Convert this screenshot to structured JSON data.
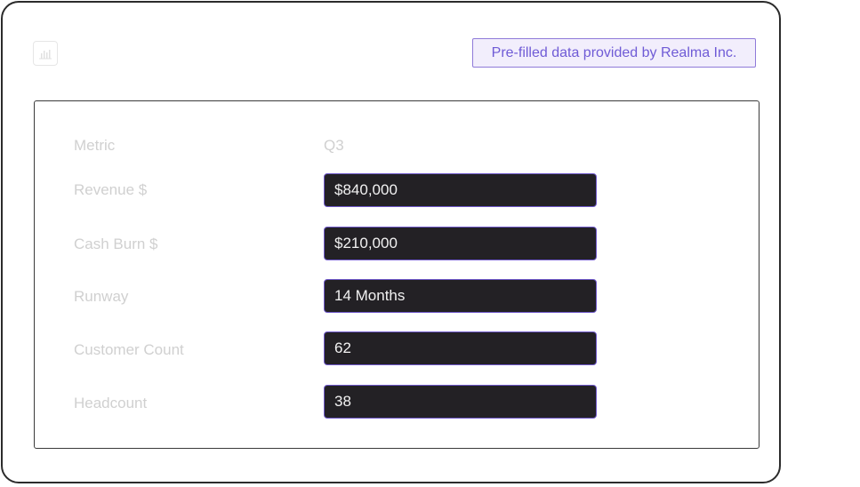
{
  "header": {
    "chart_icon": "bar-chart-icon",
    "prefill_notice": "Pre-filled data provided by Realma Inc."
  },
  "table": {
    "columns": {
      "metric": "Metric",
      "period": "Q3"
    },
    "rows": [
      {
        "label": "Revenue $",
        "value": "$840,000"
      },
      {
        "label": "Cash Burn $",
        "value": "$210,000"
      },
      {
        "label": "Runway",
        "value": "14 Months"
      },
      {
        "label": "Customer Count",
        "value": "62"
      },
      {
        "label": "Headcount",
        "value": "38"
      }
    ]
  },
  "colors": {
    "accent": "#6e58c9",
    "badge_text": "#6f5bd6",
    "field_background": "#232125",
    "label_text": "#d0d0d0"
  }
}
